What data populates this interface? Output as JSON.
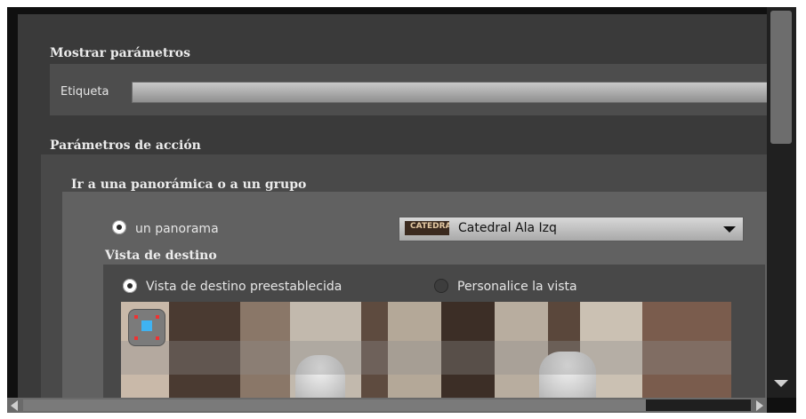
{
  "display_params": {
    "title": "Mostrar parámetros",
    "label": "Etiqueta",
    "label_value": ""
  },
  "action_params": {
    "title": "Parámetros de acción",
    "group_title": "Ir a una panorámica o a un grupo",
    "panorama_option": "un panorama",
    "panorama_selected": "Catedral Ala Izq",
    "thumbnail_text": "CATEDRAL"
  },
  "target_view": {
    "title": "Vista de destino",
    "preset_option": "Vista de destino preestablecida",
    "custom_option": "Personalice la vista"
  },
  "colors": {
    "nav_square": "#3fb3f2",
    "nav_dots": "#ee3333"
  }
}
